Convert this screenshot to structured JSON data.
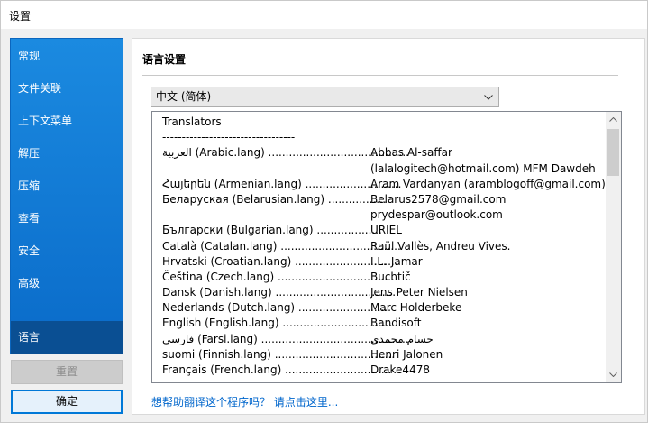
{
  "window": {
    "title": "设置"
  },
  "sidebar": {
    "items": [
      {
        "label": "常规",
        "active": false
      },
      {
        "label": "文件关联",
        "active": false
      },
      {
        "label": "上下文菜单",
        "active": false
      },
      {
        "label": "解压",
        "active": false
      },
      {
        "label": "压缩",
        "active": false
      },
      {
        "label": "查看",
        "active": false
      },
      {
        "label": "安全",
        "active": false
      },
      {
        "label": "高级",
        "active": false
      },
      {
        "label": "语言",
        "active": true
      }
    ]
  },
  "buttons": {
    "reset": "重置",
    "ok": "确定"
  },
  "panel": {
    "title": "语言设置",
    "language_select": {
      "value": "中文 (简体)"
    },
    "translators": {
      "header": "Translators",
      "separator": "----------------------------------",
      "lines": [
        {
          "lang": "العربية (Arabic.lang) .........................................",
          "who": "Abbas Al-saffar"
        },
        {
          "lang": "",
          "who": "(lalalogitech@hotmail.com) MFM Dawdeh"
        },
        {
          "lang": "Հայերեն (Armenian.lang) ............................",
          "who": "Aram Vardanyan (aramblogoff@gmail.com)"
        },
        {
          "lang": "Беларуская (Belarusian.lang) ..................",
          "who": "Belarus2578@gmail.com"
        },
        {
          "lang": "",
          "who": "prydespar@outlook.com"
        },
        {
          "lang": "Български (Bulgarian.lang) ...................",
          "who": "URIEL"
        },
        {
          "lang": "Català (Catalan.lang) ...................................",
          "who": "Raül Vallès, Andreu Vives."
        },
        {
          "lang": "Hrvatski (Croatian.lang) ..............................",
          "who": "I.L.-Jamar"
        },
        {
          "lang": "Čeština (Czech.lang) ...................................",
          "who": "Buchtič"
        },
        {
          "lang": "Dansk (Danish.lang) ....................................",
          "who": "Jens Peter Nielsen"
        },
        {
          "lang": "Nederlands (Dutch.lang) ...........................",
          "who": "Marc Holderbeke"
        },
        {
          "lang": "English (English.lang) ................................",
          "who": "Bandisoft"
        },
        {
          "lang": "فارسی (Farsi.lang) ............................................",
          "who": "حسام محمدی"
        },
        {
          "lang": "suomi (Finnish.lang) ...................................",
          "who": "Henri Jalonen"
        },
        {
          "lang": "Français (French.lang) ...............................",
          "who": "Drake4478"
        }
      ]
    },
    "help_link": "想帮助翻译这个程序吗？ 请点击这里..."
  }
}
